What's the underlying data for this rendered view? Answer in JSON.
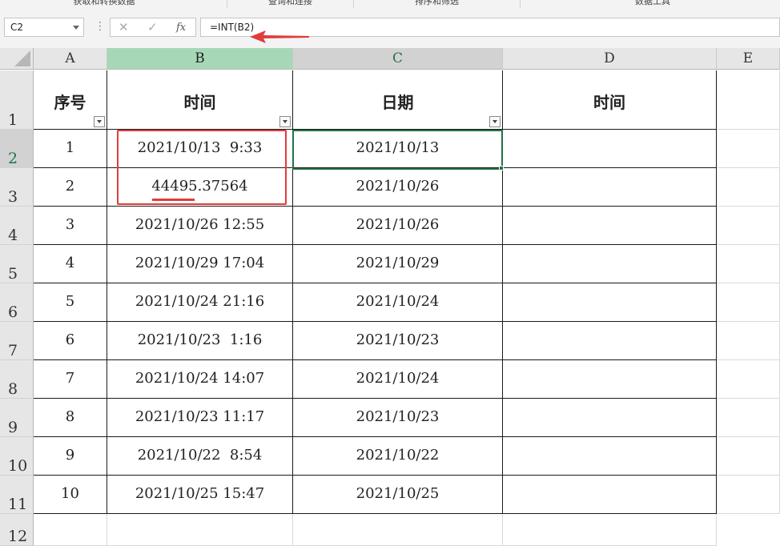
{
  "ribbon": {
    "groups": [
      "获取和转换数据",
      "查询和连接",
      "排序和筛选",
      "数据工具"
    ]
  },
  "formula_bar": {
    "name_box": "C2",
    "formula": "=INT(B2)",
    "fx_label": "fx"
  },
  "columns": [
    "A",
    "B",
    "C",
    "D",
    "E"
  ],
  "rows": [
    "1",
    "2",
    "3",
    "4",
    "5",
    "6",
    "7",
    "8",
    "9",
    "10",
    "11",
    "12"
  ],
  "table": {
    "headers": [
      "序号",
      "时间",
      "日期",
      "时间"
    ],
    "rows": [
      [
        "1",
        "2021/10/13  9:33",
        "2021/10/13",
        ""
      ],
      [
        "2",
        "44495.37564",
        "2021/10/26",
        ""
      ],
      [
        "3",
        "2021/10/26 12:55",
        "2021/10/26",
        ""
      ],
      [
        "4",
        "2021/10/29 17:04",
        "2021/10/29",
        ""
      ],
      [
        "5",
        "2021/10/24 21:16",
        "2021/10/24",
        ""
      ],
      [
        "6",
        "2021/10/23  1:16",
        "2021/10/23",
        ""
      ],
      [
        "7",
        "2021/10/24 14:07",
        "2021/10/24",
        ""
      ],
      [
        "8",
        "2021/10/23 11:17",
        "2021/10/23",
        ""
      ],
      [
        "9",
        "2021/10/22  8:54",
        "2021/10/22",
        ""
      ],
      [
        "10",
        "2021/10/25 15:47",
        "2021/10/25",
        ""
      ]
    ]
  },
  "colors": {
    "accent": "#217346",
    "annotation": "#e03c3c",
    "selected_col_header": "#a6d8b8"
  }
}
